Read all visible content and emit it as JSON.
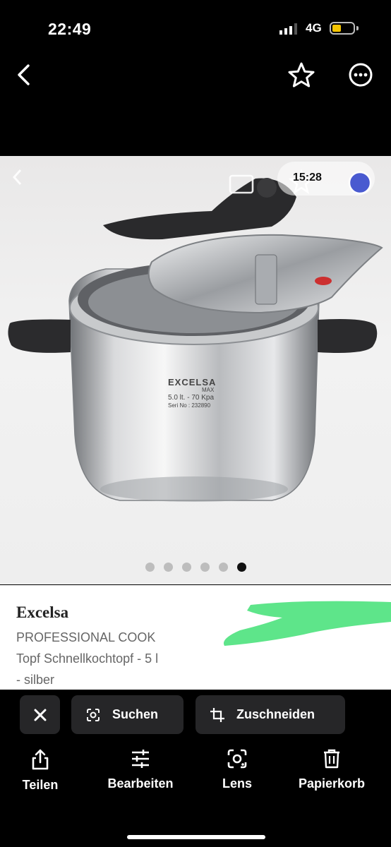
{
  "status_bar": {
    "time": "22:49",
    "network": "4G"
  },
  "header": {
    "back_icon": "chevron-left-icon",
    "favorite_icon": "star-icon",
    "more_icon": "more-horizontal-icon"
  },
  "photo": {
    "overlay_time": "15:28",
    "engraving": {
      "brand": "EXCELSA",
      "max": "MAX",
      "spec": "5.0 lt. - 70 Kpa",
      "serial": "Seri No : 232890"
    },
    "pagination": {
      "count": 6,
      "active_index": 5
    }
  },
  "product": {
    "brand": "Excelsa",
    "line1": "PROFESSIONAL COOK",
    "line2": "Topf Schnellkochtopf - 5 l",
    "line3": "- silber",
    "redaction_color": "#5ee58a"
  },
  "chips": {
    "search_label": "Suchen",
    "crop_label": "Zuschneiden"
  },
  "toolbar": {
    "share_label": "Teilen",
    "edit_label": "Bearbeiten",
    "lens_label": "Lens",
    "trash_label": "Papierkorb"
  }
}
